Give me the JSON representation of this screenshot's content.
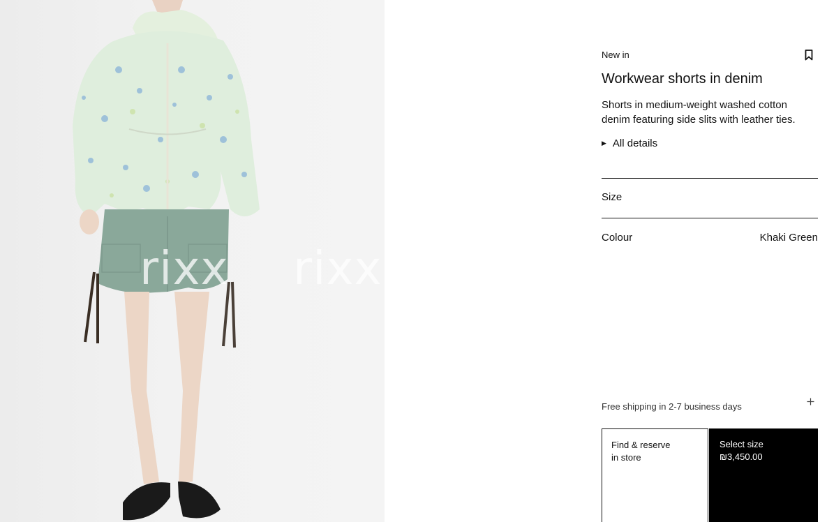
{
  "product": {
    "badge": "New in",
    "title": "Workwear shorts in denim",
    "description": "Shorts in medium-weight washed cotton denim featuring side slits with leather ties.",
    "details_label": "All details"
  },
  "options": {
    "size_label": "Size",
    "colour_label": "Colour",
    "colour_value": "Khaki Green"
  },
  "shipping": {
    "text": "Free shipping in 2-7 business days"
  },
  "actions": {
    "store_line1": "Find & reserve",
    "store_line2": "in store",
    "select_label": "Select size",
    "price": "₪3,450.00"
  },
  "image": {
    "watermark": "rixx"
  },
  "icons": {
    "bookmark": "bookmark-icon",
    "expand": "plus-icon",
    "details_toggle": "triangle-right-icon"
  },
  "colors": {
    "accent": "#000000",
    "shorts": "#8aa89a",
    "jacket": "#dfeedd"
  }
}
